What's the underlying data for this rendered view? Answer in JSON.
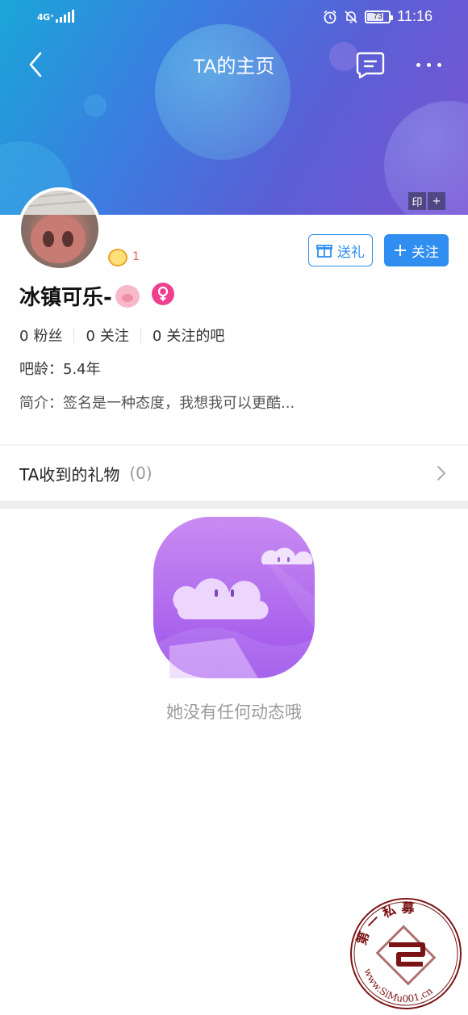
{
  "status_bar": {
    "network": "4G⁺",
    "battery": "73",
    "time": "11:16"
  },
  "header": {
    "title": "TA的主页",
    "tag_left": "印",
    "tag_right": "+"
  },
  "profile": {
    "badge_count": "1",
    "username": "冰镇可乐-",
    "gift_button": "送礼",
    "follow_button": "关注",
    "stats": [
      {
        "value": "0",
        "label": "粉丝"
      },
      {
        "value": "0",
        "label": "关注"
      },
      {
        "value": "0",
        "label": "关注的吧"
      }
    ],
    "age": "吧龄：5.4年",
    "intro": "简介：签名是一种态度，我想我可以更酷..."
  },
  "gifts": {
    "label": "TA收到的礼物",
    "count": "(0)"
  },
  "empty_state": {
    "text": "她没有任何动态哦"
  },
  "watermark": {
    "top_text": "第 一 私 募",
    "bottom_text": "www.SiMu001.cn"
  },
  "colors": {
    "accent": "#2f8ef0",
    "gender": "#ef3f8f",
    "header_start": "#1aa6d8",
    "header_end": "#7c54d2"
  }
}
